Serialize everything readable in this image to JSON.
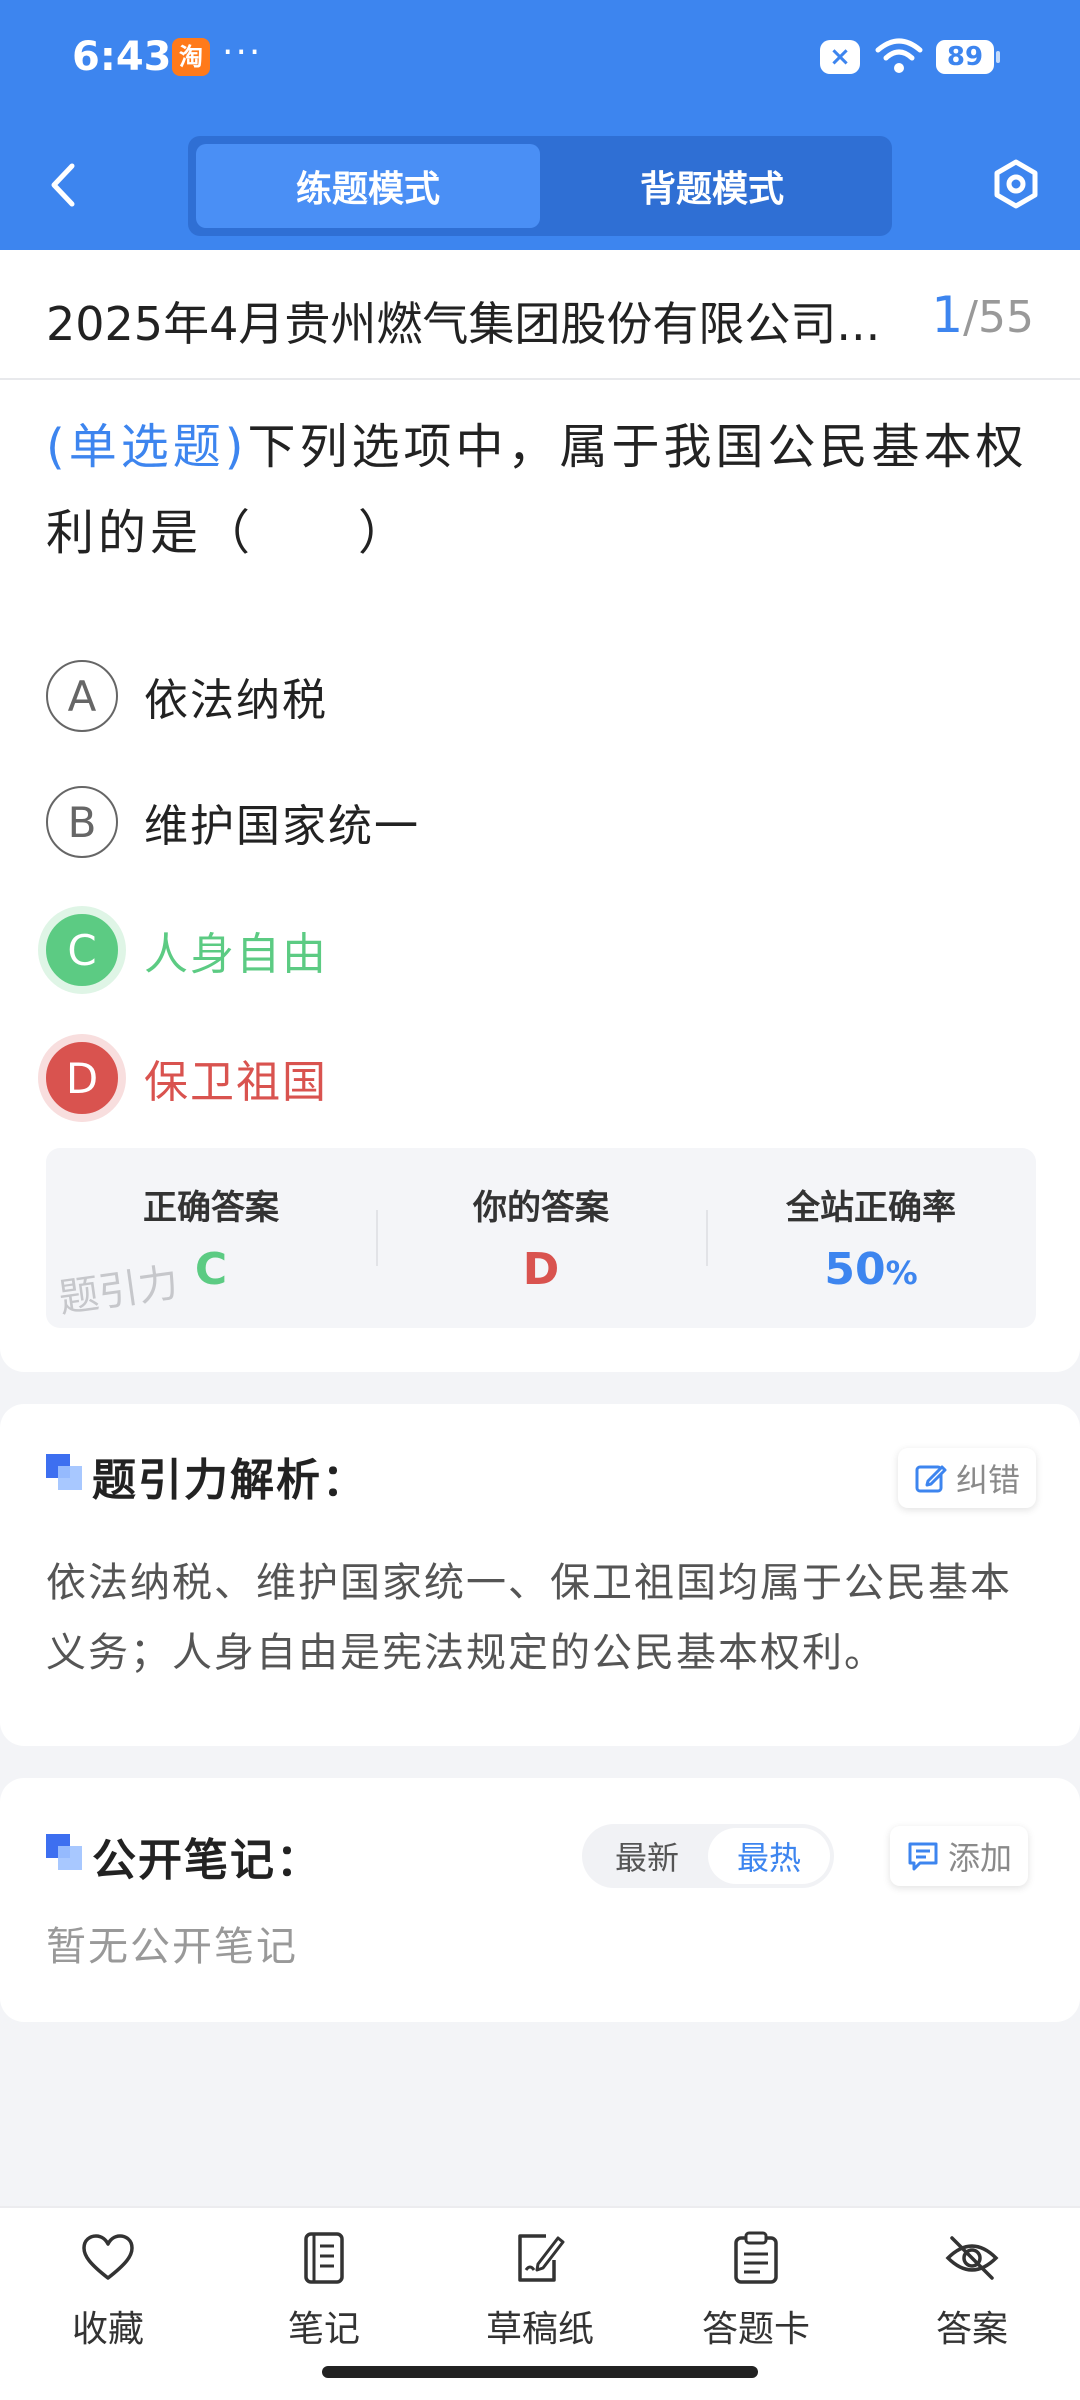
{
  "status_bar": {
    "time": "6:43",
    "app_icon_label": "淘",
    "more_dots": "···",
    "battery": "89"
  },
  "header": {
    "tabs": [
      {
        "label": "练题模式",
        "active": true
      },
      {
        "label": "背题模式",
        "active": false
      }
    ]
  },
  "paper": {
    "title": "2025年4月贵州燃气集团股份有限公司...",
    "current": "1",
    "separator": "/",
    "total": "55"
  },
  "question": {
    "type_label": "(单选题)",
    "text": "下列选项中，属于我国公民基本权利的是（　　）",
    "options": [
      {
        "letter": "A",
        "text": "依法纳税",
        "state": "normal"
      },
      {
        "letter": "B",
        "text": "维护国家统一",
        "state": "normal"
      },
      {
        "letter": "C",
        "text": "人身自由",
        "state": "correct"
      },
      {
        "letter": "D",
        "text": "保卫祖国",
        "state": "wrong"
      }
    ]
  },
  "answer_summary": {
    "correct_label": "正确答案",
    "correct_value": "C",
    "mine_label": "你的答案",
    "mine_value": "D",
    "rate_label": "全站正确率",
    "rate_value": "50",
    "rate_unit": "%",
    "watermark": "题引力"
  },
  "analysis": {
    "title": "题引力解析：",
    "report_label": "纠错",
    "text": "依法纳税、维护国家统一、保卫祖国均属于公民基本义务；人身自由是宪法规定的公民基本权利。"
  },
  "notes": {
    "title": "公开笔记：",
    "sort_options": [
      {
        "label": "最新",
        "active": false
      },
      {
        "label": "最热",
        "active": true
      }
    ],
    "add_label": "添加",
    "empty_text": "暂无公开笔记"
  },
  "bottom_nav": [
    {
      "label": "收藏",
      "icon": "heart-icon"
    },
    {
      "label": "笔记",
      "icon": "notebook-icon"
    },
    {
      "label": "草稿纸",
      "icon": "draft-paper-icon"
    },
    {
      "label": "答题卡",
      "icon": "answer-card-icon"
    },
    {
      "label": "答案",
      "icon": "eye-off-icon"
    }
  ],
  "colors": {
    "brand_blue": "#3d85ef",
    "correct_green": "#5ccb83",
    "wrong_red": "#d9534f"
  }
}
